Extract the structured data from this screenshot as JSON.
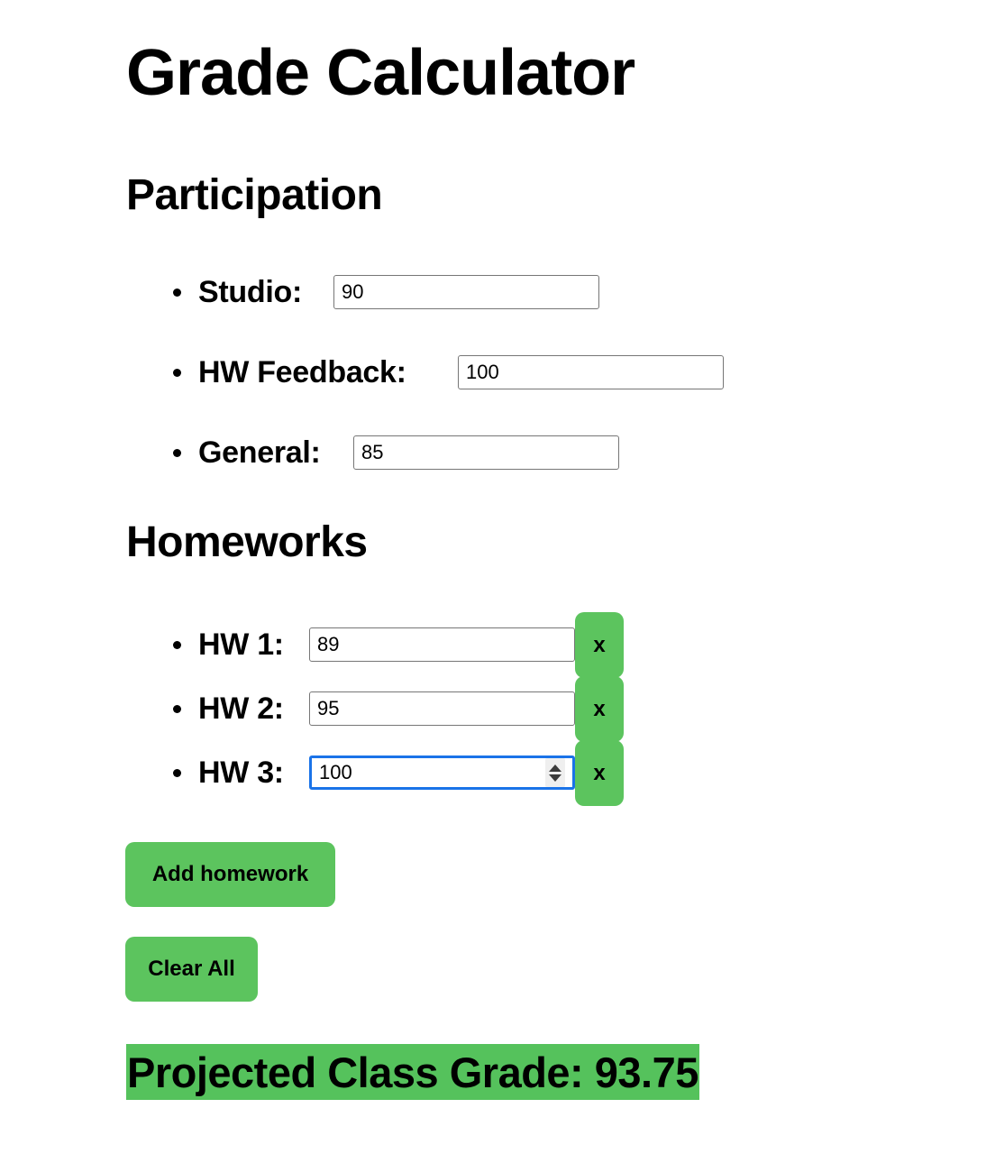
{
  "app": {
    "title": "Grade Calculator"
  },
  "participation": {
    "heading": "Participation",
    "fields": [
      {
        "label": "Studio:",
        "value": "90",
        "label_width": 150
      },
      {
        "label": "HW Feedback:",
        "value": "100",
        "label_width": 288
      },
      {
        "label": "General:",
        "value": "85",
        "label_width": 175
      }
    ]
  },
  "homeworks": {
    "heading": "Homeworks",
    "remove_label": "x",
    "items": [
      {
        "label": "HW 1:",
        "value": "89",
        "focused": false
      },
      {
        "label": "HW 2:",
        "value": "95",
        "focused": false
      },
      {
        "label": "HW 3:",
        "value": "100",
        "focused": true
      }
    ]
  },
  "actions": {
    "add_homework_label": "Add homework",
    "clear_all_label": "Clear All"
  },
  "result": {
    "text": "Projected Class Grade: 93.75",
    "label": "Projected Class Grade:",
    "value": "93.75"
  },
  "colors": {
    "accent_green": "#5cc45e",
    "banner_green": "#55c25c",
    "focus_blue": "#1a73e8",
    "input_border": "#767676",
    "text": "#000000",
    "background": "#ffffff"
  }
}
